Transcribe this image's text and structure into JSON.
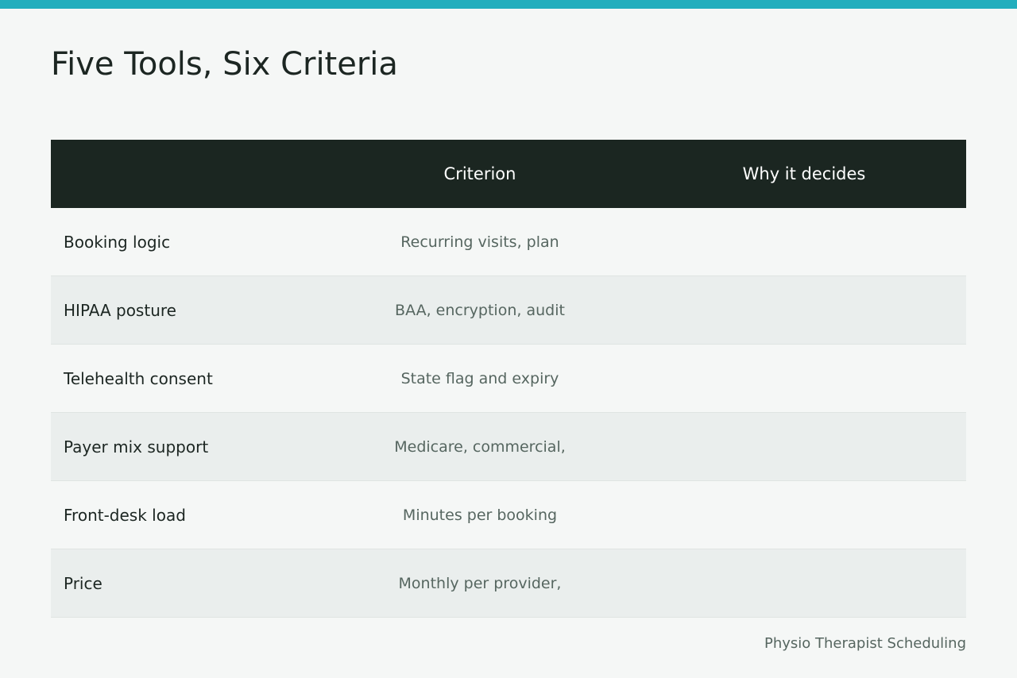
{
  "colors": {
    "accent_bar": "#23aebd",
    "header_background": "#1b2621"
  },
  "title": "Five Tools, Six Criteria",
  "table": {
    "headers": [
      "",
      "Criterion",
      "Why it decides"
    ],
    "rows": [
      {
        "name": "Booking logic",
        "criterion": "Recurring visits, plan",
        "why": ""
      },
      {
        "name": "HIPAA posture",
        "criterion": "BAA, encryption, audit",
        "why": ""
      },
      {
        "name": "Telehealth consent",
        "criterion": "State flag and expiry",
        "why": ""
      },
      {
        "name": "Payer mix support",
        "criterion": "Medicare, commercial,",
        "why": ""
      },
      {
        "name": "Front-desk load",
        "criterion": "Minutes per booking",
        "why": ""
      },
      {
        "name": "Price",
        "criterion": "Monthly per provider,",
        "why": ""
      }
    ]
  },
  "footer": {
    "caption": "Physio Therapist Scheduling"
  }
}
